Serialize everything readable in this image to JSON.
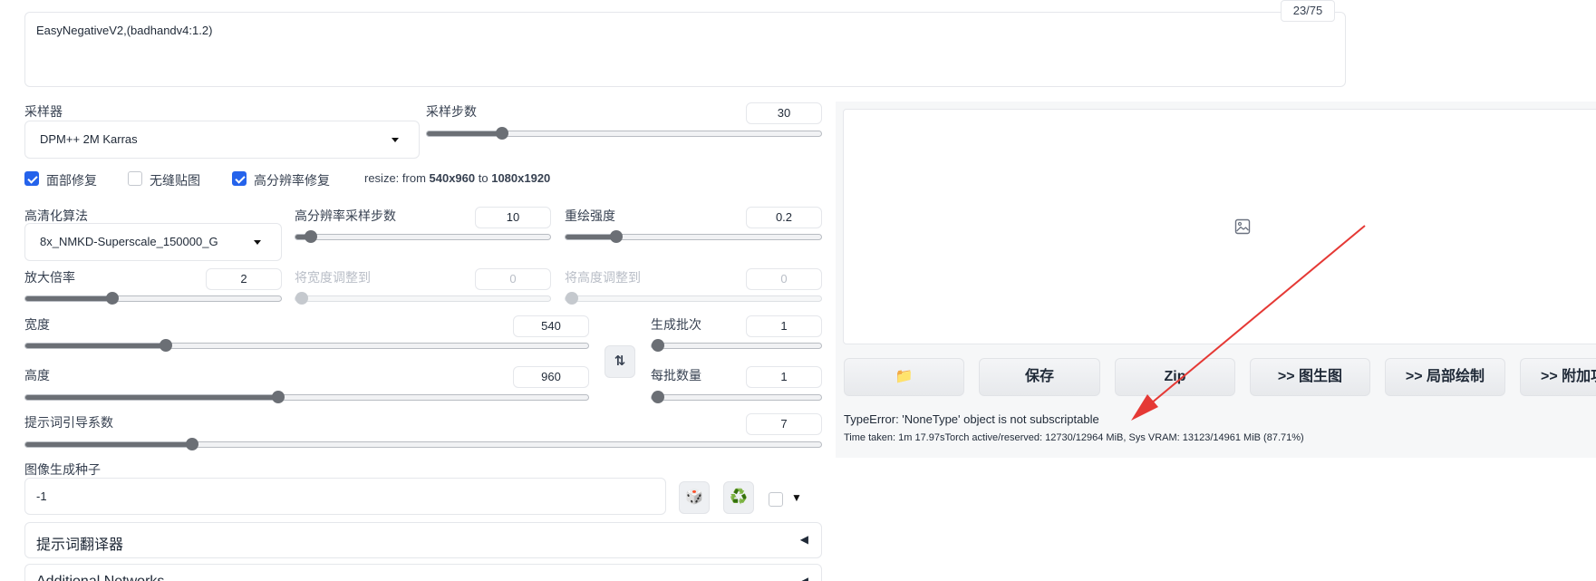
{
  "prompt": {
    "negative_text": "EasyNegativeV2,(badhandv4:1.2)",
    "token_count": "23/75"
  },
  "sampler": {
    "label": "采样器",
    "value": "DPM++ 2M Karras"
  },
  "steps": {
    "label": "采样步数",
    "value": "30",
    "level": 0.19
  },
  "checkboxes": [
    {
      "label": "面部修复",
      "checked": true
    },
    {
      "label": "无缝贴图",
      "checked": false
    },
    {
      "label": "高分辨率修复",
      "checked": true
    }
  ],
  "resize_info": {
    "prefix": "resize: from ",
    "from": "540x960",
    "mid": " to ",
    "to": "1080x1920"
  },
  "upscaler": {
    "label": "高清化算法",
    "value": "8x_NMKD-Superscale_150000_G"
  },
  "hires_steps": {
    "label": "高分辨率采样步数",
    "value": "10",
    "level": 0.06
  },
  "denoise": {
    "label": "重绘强度",
    "value": "0.2",
    "level": 0.2
  },
  "upscale_by": {
    "label": "放大倍率",
    "value": "2",
    "level": 0.34
  },
  "resize_width": {
    "label": "将宽度调整到",
    "value": "0"
  },
  "resize_height": {
    "label": "将高度调整到",
    "value": "0"
  },
  "width": {
    "label": "宽度",
    "value": "540",
    "level": 0.25
  },
  "height": {
    "label": "高度",
    "value": "960",
    "level": 0.45
  },
  "swap_icon": "swap-vertical-icon",
  "batch_count": {
    "label": "生成批次",
    "value": "1",
    "level": 0
  },
  "batch_size": {
    "label": "每批数量",
    "value": "1",
    "level": 0
  },
  "cfg_scale": {
    "label": "提示词引导系数",
    "value": "7",
    "level": 0.21
  },
  "seed": {
    "label": "图像生成种子",
    "value": "-1",
    "dice_glyph": "🎲",
    "recycle_glyph": "♻️",
    "extra_arrow": "▼"
  },
  "accordions": [
    {
      "label": "提示词翻译器",
      "arrow": "◀"
    },
    {
      "label": "Additional Networks",
      "arrow": "◀"
    }
  ],
  "output": {
    "image_placeholder_icon": "image-icon",
    "buttons": [
      {
        "label": "📁",
        "name": "open-folder-button"
      },
      {
        "label": "保存",
        "name": "save-button"
      },
      {
        "label": "Zip",
        "name": "zip-button"
      },
      {
        "label": ">> 图生图",
        "name": "send-to-img2img-button"
      },
      {
        "label": ">> 局部绘制",
        "name": "send-to-inpaint-button"
      },
      {
        "label": ">> 附加功能",
        "name": "send-to-extras-button"
      }
    ],
    "error": "TypeError: 'NoneType' object is not subscriptable",
    "time_taken": "Time taken: 1m 17.97sTorch active/reserved: 12730/12964 MiB, Sys VRAM: 13123/14961 MiB (87.71%)"
  },
  "colors": {
    "checkbox_accent": "#2563eb",
    "arrow": "#e53935",
    "folder": "#f5b301",
    "recycle": "#1aa34a"
  }
}
